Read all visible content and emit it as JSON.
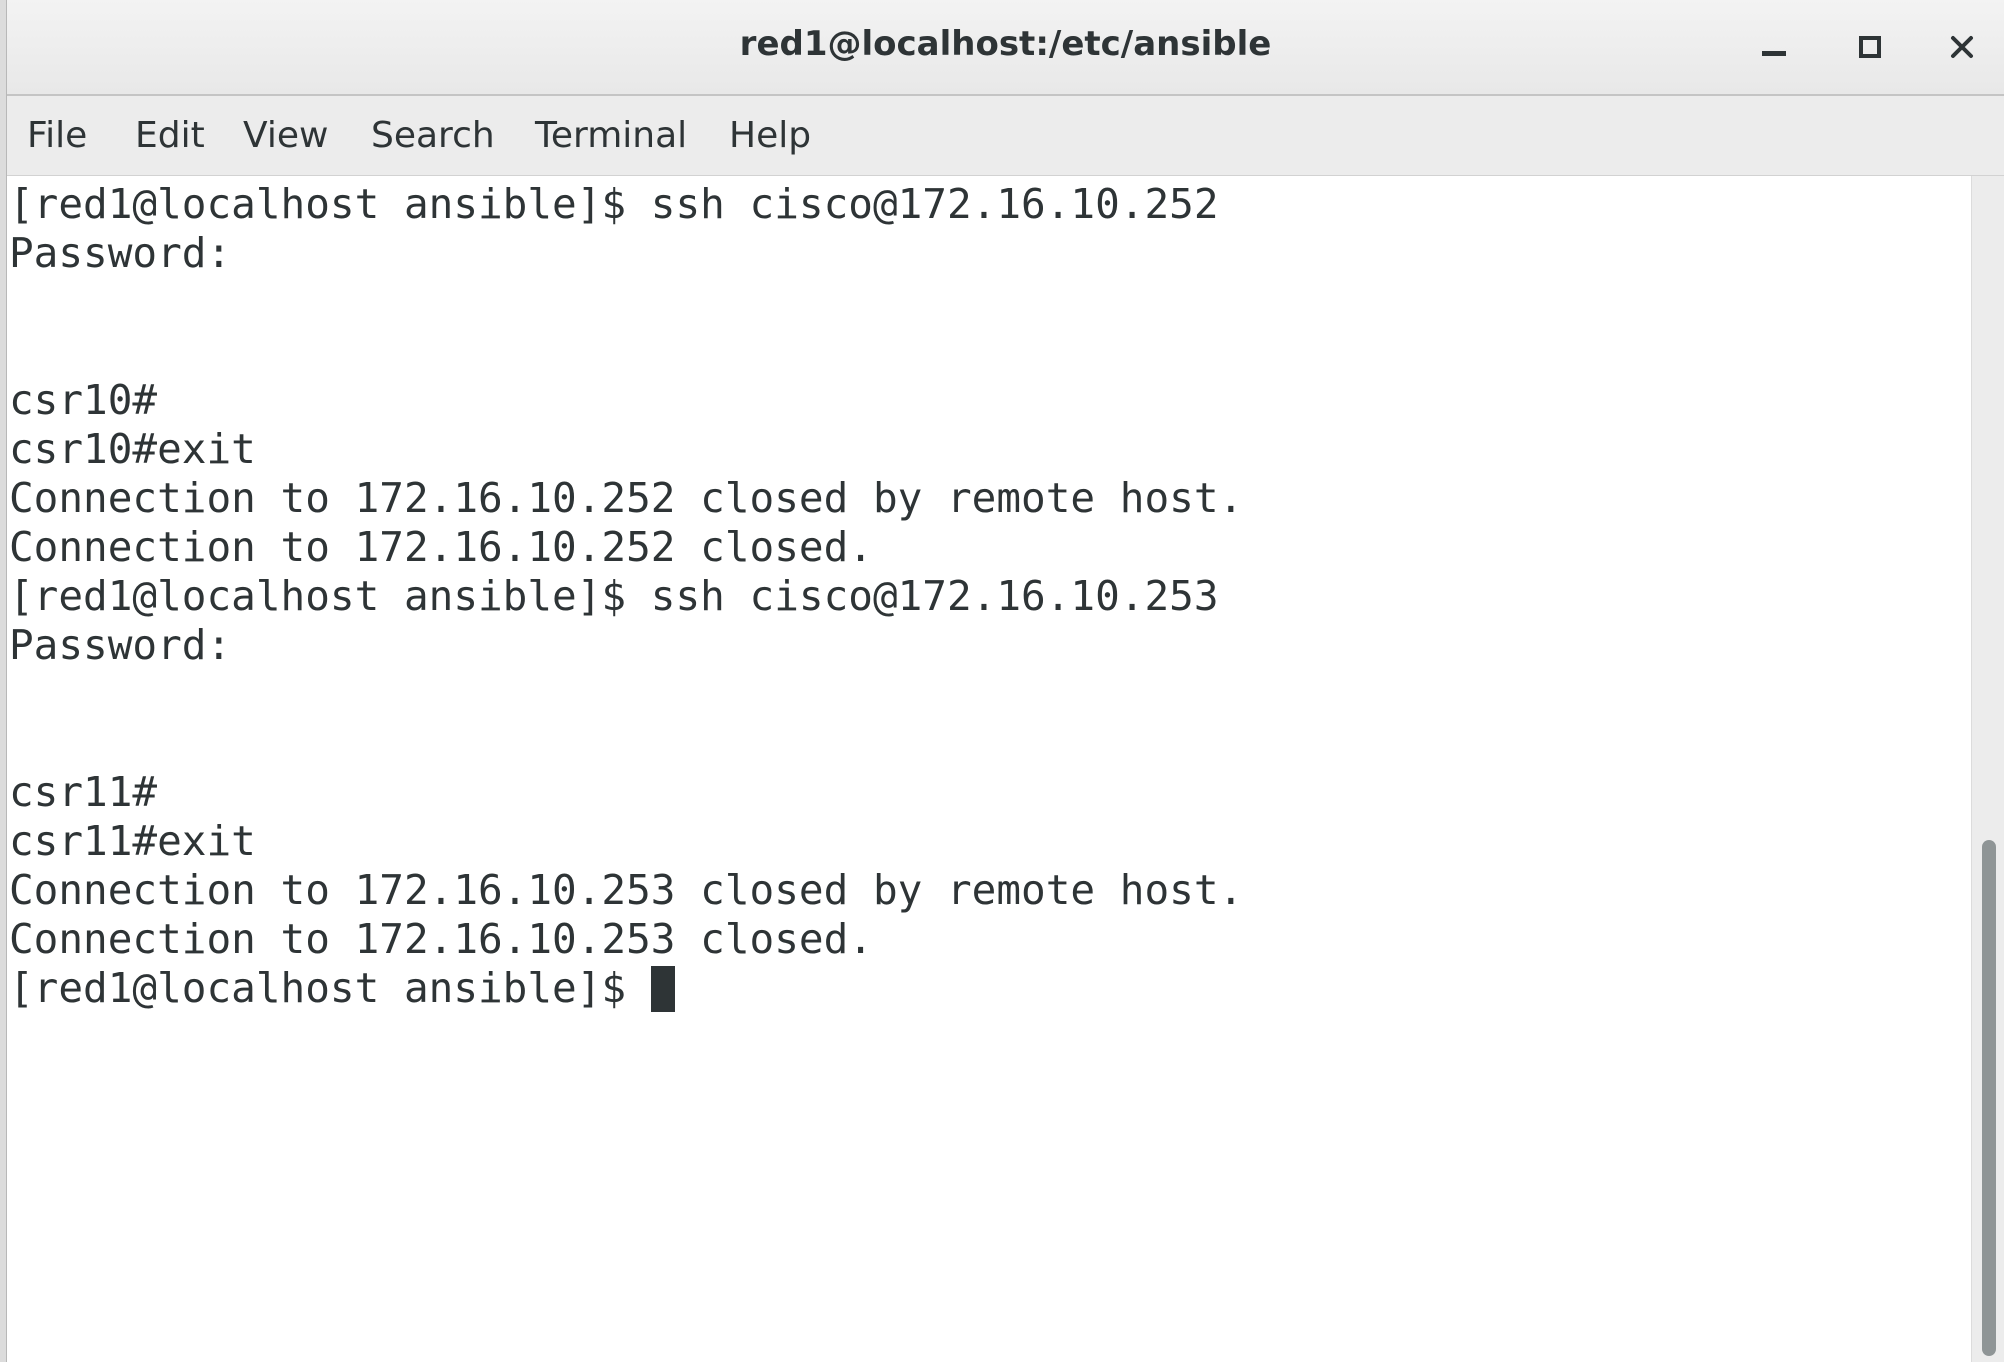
{
  "window": {
    "title": "red1@localhost:/etc/ansible"
  },
  "menu": {
    "items": [
      "File",
      "Edit",
      "View",
      "Search",
      "Terminal",
      "Help"
    ]
  },
  "terminal": {
    "lines": [
      "[red1@localhost ansible]$ ssh cisco@172.16.10.252",
      "Password:",
      "",
      "",
      "csr10#",
      "csr10#exit",
      "Connection to 172.16.10.252 closed by remote host.",
      "Connection to 172.16.10.252 closed.",
      "[red1@localhost ansible]$ ssh cisco@172.16.10.253",
      "Password:",
      "",
      "",
      "csr11#",
      "csr11#exit",
      "Connection to 172.16.10.253 closed by remote host.",
      "Connection to 172.16.10.253 closed.",
      "[red1@localhost ansible]$ "
    ],
    "cursor_line": 16
  },
  "scrollbar": {
    "position_fraction": 0.56,
    "visible_fraction": 0.44
  },
  "icons": {
    "minimize": "minimize-icon",
    "maximize": "maximize-icon",
    "close": "close-icon"
  }
}
